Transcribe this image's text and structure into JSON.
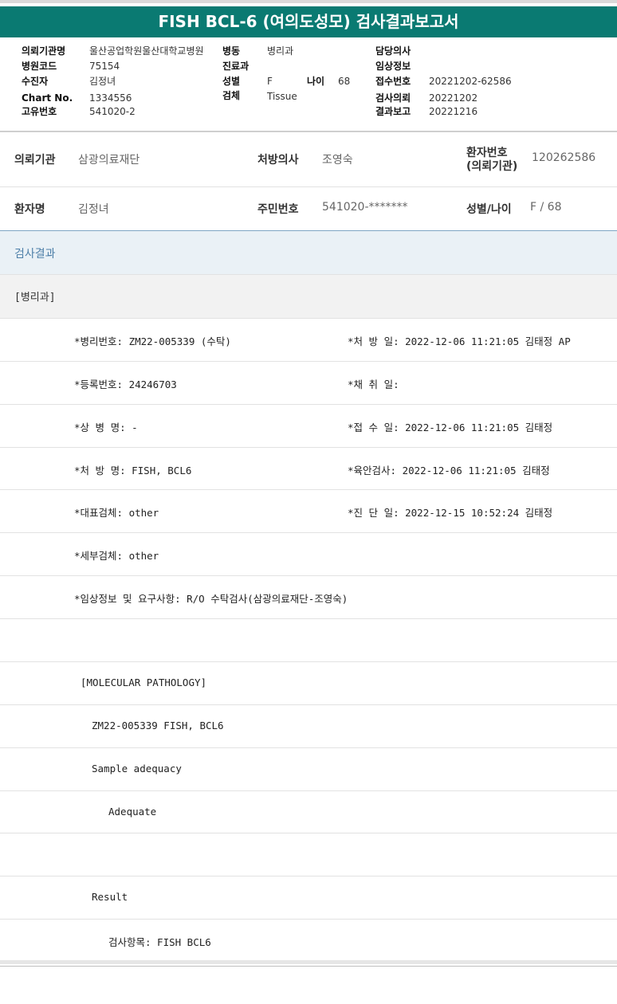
{
  "title": "FISH BCL-6 (여의도성모) 검사결과보고서",
  "header": {
    "col1": [
      {
        "label": "의뢰기관명",
        "value": "울산공업학원울산대학교병원"
      },
      {
        "label": "병원코드",
        "value": "75154"
      },
      {
        "label": "수진자",
        "value": "김정녀"
      },
      {
        "label": "Chart No.",
        "value": "1334556"
      },
      {
        "label": "고유번호",
        "value": "541020-2"
      }
    ],
    "col2": [
      {
        "label": "병동",
        "value": "병리과"
      },
      {
        "label": "진료과",
        "value": ""
      },
      {
        "label": "성별",
        "value": "F"
      },
      {
        "label": "검체",
        "value": "Tissue"
      }
    ],
    "age": {
      "label": "나이",
      "value": "68"
    },
    "col3": [
      {
        "label": "담당의사",
        "value": ""
      },
      {
        "label": "임상정보",
        "value": ""
      },
      {
        "label": "접수번호",
        "value": "20221202-62586"
      },
      {
        "label": "검사의뢰",
        "value": "20221202"
      },
      {
        "label": "결과보고",
        "value": "20221216"
      }
    ]
  },
  "patient": {
    "institution_label": "의뢰기관",
    "institution": "삼광의료재단",
    "doctor_label": "처방의사",
    "doctor": "조영숙",
    "pid_label_1": "환자번호",
    "pid_label_2": "(의뢰기관)",
    "pid": "120262586",
    "name_label": "환자명",
    "name": "김정녀",
    "rrn_label": "주민번호",
    "rrn": "541020-*******",
    "sexage_label": "성별/나이",
    "sexage": "F / 68"
  },
  "results": {
    "section_title": "검사결과",
    "dept": "[병리과]",
    "rows": [
      {
        "left": "*병리번호: ZM22-005339 (수탁)",
        "right": "*처 방 일: 2022-12-06 11:21:05  김태정 AP"
      },
      {
        "left": "*등록번호: 24246703",
        "right": "*채 취 일:"
      },
      {
        "left": "*상 병 명: -",
        "right": "*접 수 일: 2022-12-06 11:21:05  김태정"
      },
      {
        "left": "*처 방 명: FISH, BCL6",
        "right": "*육안검사: 2022-12-06 11:21:05  김태정"
      },
      {
        "left": "*대표검체: other",
        "right": "*진 단 일: 2022-12-15 10:52:24  김태정"
      },
      {
        "left": "*세부검체: other",
        "right": ""
      },
      {
        "left": "*임상정보 및 요구사항: R/O 수탁검사(삼광의료재단-조영숙)",
        "right": ""
      }
    ],
    "report": [
      "",
      "[MOLECULAR PATHOLOGY]",
      "ZM22-005339     FISH, BCL6",
      "Sample adequacy",
      "Adequate",
      "",
      "Result",
      "검사항목: FISH BCL6"
    ]
  },
  "colors": {
    "title_bg": "#0a7a72",
    "section_accent": "#4d7fa8"
  }
}
